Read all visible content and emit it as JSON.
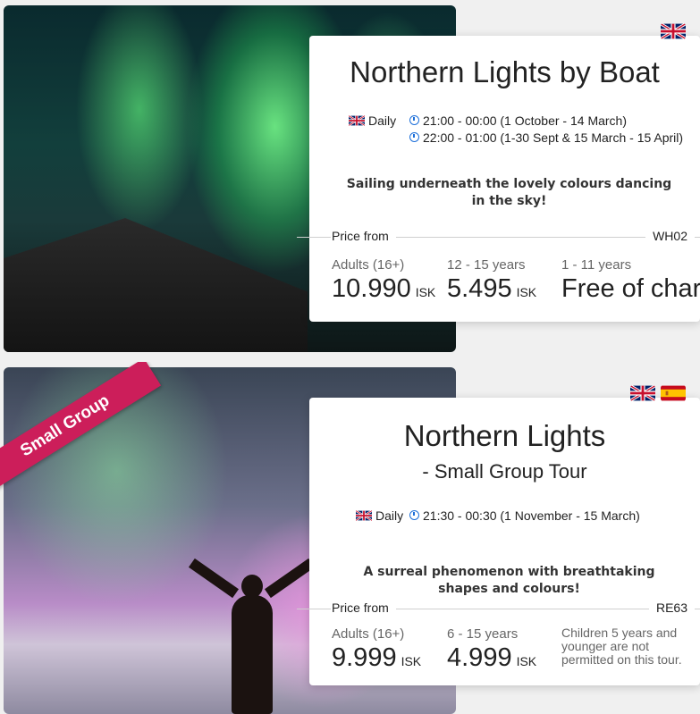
{
  "tours": [
    {
      "ribbon": "",
      "title": "Northern Lights by Boat",
      "subtitle": "",
      "languages": [
        "english-flag"
      ],
      "schedule": [
        {
          "day": "Daily",
          "time": "21:00 - 00:00 (1 October - 14 March)"
        },
        {
          "day": "",
          "time": "22:00 - 01:00 (1-30 Sept & 15 March - 15 April)"
        }
      ],
      "tagline": "Sailing underneath the lovely colours dancing in the sky!",
      "price_from": "Price from",
      "code": "WH02",
      "prices": [
        {
          "label": "Adults (16+)",
          "value": "10.990",
          "currency": "ISK"
        },
        {
          "label": "12 - 15 years",
          "value": "5.495",
          "currency": "ISK"
        },
        {
          "label": "1 - 11 years",
          "value": "Free of charge",
          "currency": ""
        }
      ]
    },
    {
      "ribbon": "Small Group",
      "title": "Northern Lights",
      "subtitle": "- Small Group Tour",
      "languages": [
        "english-flag",
        "spanish-flag"
      ],
      "schedule": [
        {
          "day": "Daily",
          "time": "21:30 - 00:30 (1 November - 15 March)"
        }
      ],
      "tagline": "A surreal phenomenon with breathtaking shapes and colours!",
      "price_from": "Price from",
      "code": "RE63",
      "prices": [
        {
          "label": "Adults (16+)",
          "value": "9.999",
          "currency": "ISK"
        },
        {
          "label": "6 - 15 years",
          "value": "4.999",
          "currency": "ISK"
        },
        {
          "label": "",
          "value": "",
          "currency": "",
          "note": "Children 5 years and younger are not permitted on this tour."
        }
      ]
    }
  ],
  "colors": {
    "ribbon": "#cc1e5a",
    "clock": "#1d6fd9"
  }
}
